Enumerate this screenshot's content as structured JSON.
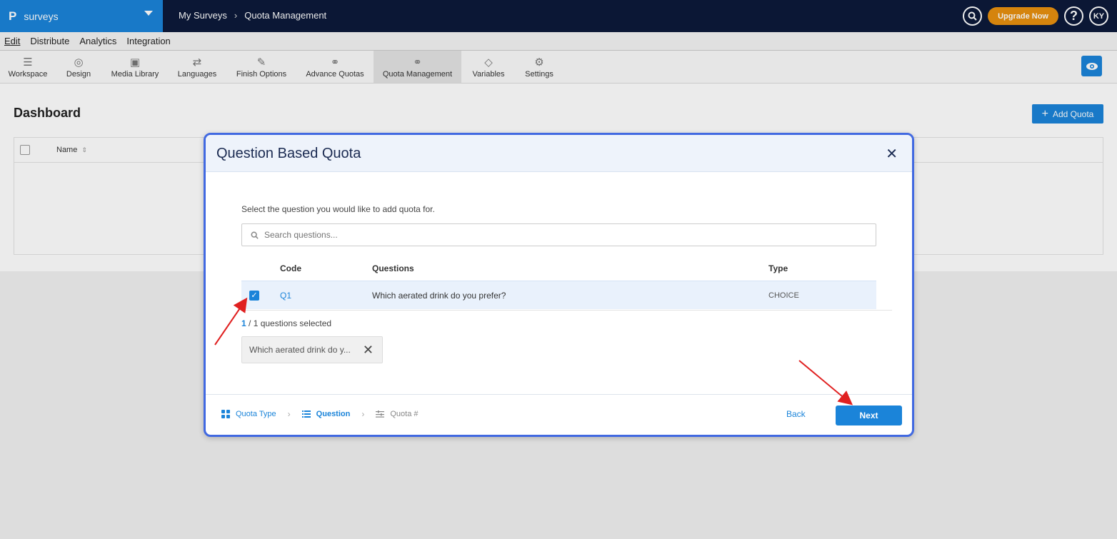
{
  "topbar": {
    "brand_logo": "P",
    "brand_name": "surveys",
    "breadcrumb": [
      "My Surveys",
      "Quota Management"
    ],
    "upgrade_label": "Upgrade Now",
    "help_label": "?",
    "avatar_initials": "KY"
  },
  "menu": [
    "Edit",
    "Distribute",
    "Analytics",
    "Integration"
  ],
  "toolbar": [
    {
      "label": "Workspace",
      "icon": "workspace-icon"
    },
    {
      "label": "Design",
      "icon": "palette-icon"
    },
    {
      "label": "Media Library",
      "icon": "image-icon"
    },
    {
      "label": "Languages",
      "icon": "translate-icon"
    },
    {
      "label": "Finish Options",
      "icon": "wand-icon"
    },
    {
      "label": "Advance Quotas",
      "icon": "link-icon"
    },
    {
      "label": "Quota Management",
      "icon": "link-icon"
    },
    {
      "label": "Variables",
      "icon": "tag-icon"
    },
    {
      "label": "Settings",
      "icon": "gear-icon"
    }
  ],
  "page": {
    "title": "Dashboard",
    "add_quota_label": "Add Quota",
    "table_name_header": "Name"
  },
  "modal": {
    "title": "Question Based Quota",
    "instruction": "Select the question you would like to add quota for.",
    "search_placeholder": "Search questions...",
    "columns": {
      "code": "Code",
      "questions": "Questions",
      "type": "Type"
    },
    "rows": [
      {
        "code": "Q1",
        "question": "Which aerated drink do you prefer?",
        "type": "CHOICE",
        "checked": true
      }
    ],
    "selected_count": "1",
    "selected_suffix": " / 1 questions selected",
    "chip_label": "Which aerated drink do y...",
    "steps": [
      {
        "label": "Quota Type",
        "state": "done"
      },
      {
        "label": "Question",
        "state": "current"
      },
      {
        "label": "Quota #",
        "state": "todo"
      }
    ],
    "back_label": "Back",
    "next_label": "Next"
  },
  "colors": {
    "brand": "#1b84d9",
    "topbar": "#0c1a3a",
    "upgrade": "#e8900f",
    "modal_border": "#4169e1",
    "annotation_arrow": "#e02020"
  }
}
